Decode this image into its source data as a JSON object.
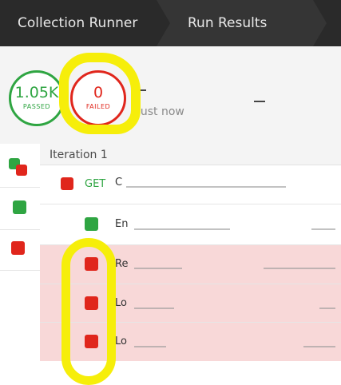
{
  "header": {
    "crumb_collection_runner": "Collection Runner",
    "crumb_run_results": "Run Results"
  },
  "summary": {
    "passed_count": "1.05K",
    "passed_label": "PASSED",
    "failed_count": "0",
    "failed_label": "FAILED",
    "run_time": "just now"
  },
  "iteration": {
    "label": "Iteration 1",
    "rows": [
      {
        "status": "failed",
        "method": "GET",
        "text": "C"
      },
      {
        "status": "passed",
        "text": "En"
      },
      {
        "status": "failed",
        "text": "Re"
      },
      {
        "status": "failed",
        "text": "Lo"
      },
      {
        "status": "failed",
        "text": "Lo"
      }
    ]
  },
  "colors": {
    "header_bg": "#2a2a2a",
    "passed": "#2fa542",
    "failed": "#e0261c",
    "failed_row_bg": "#f8d8d8",
    "annotation_highlight": "#f6ee0a"
  },
  "icons": {
    "status_passed": "green-square-icon",
    "status_failed": "red-square-icon"
  }
}
